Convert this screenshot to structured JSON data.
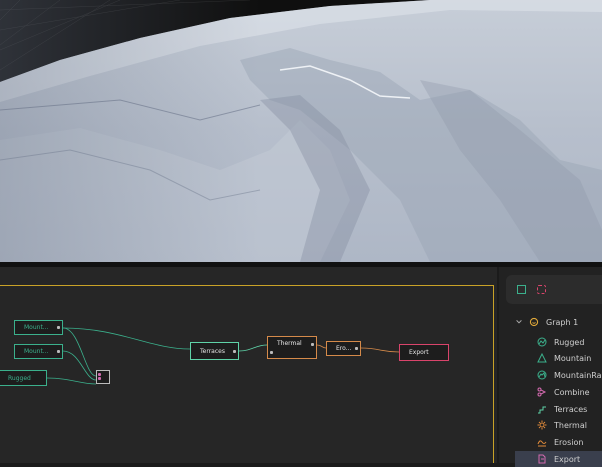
{
  "graph": {
    "nodes": [
      {
        "id": "mount1",
        "label": "Mount...",
        "color": "#3bb08c"
      },
      {
        "id": "mount2",
        "label": "Mount...",
        "color": "#3bb08c"
      },
      {
        "id": "rugged",
        "label": "Rugged",
        "color": "#3bb08c"
      },
      {
        "id": "combine",
        "label": "",
        "color": "#bbbbbb"
      },
      {
        "id": "terraces",
        "label": "Terraces",
        "color": "#5fd3a8"
      },
      {
        "id": "thermal",
        "label": "Thermal",
        "color": "#d58a4a"
      },
      {
        "id": "erosion",
        "label": "Ero...",
        "color": "#d58a4a"
      },
      {
        "id": "export",
        "label": "Export",
        "color": "#d9446b"
      }
    ]
  },
  "sidebar": {
    "toolbar_icons": [
      "fit-view-icon",
      "focus-icon"
    ],
    "tree": {
      "root_label": "Graph 1",
      "items": [
        {
          "label": "Rugged",
          "icon": "rugged-icon",
          "color": "#3bb08c"
        },
        {
          "label": "Mountain",
          "icon": "mountain-icon",
          "color": "#3bb08c"
        },
        {
          "label": "MountainRange",
          "icon": "mountain-range-icon",
          "color": "#3bb08c"
        },
        {
          "label": "Combine",
          "icon": "combine-icon",
          "color": "#d46ab0"
        },
        {
          "label": "Terraces",
          "icon": "terraces-icon",
          "color": "#5fd3a8"
        },
        {
          "label": "Thermal",
          "icon": "thermal-icon",
          "color": "#e08a3a"
        },
        {
          "label": "Erosion",
          "icon": "erosion-icon",
          "color": "#e08a3a"
        },
        {
          "label": "Export",
          "icon": "export-icon",
          "color": "#d46ab0"
        }
      ]
    }
  },
  "colors": {
    "accent_frame": "#c9a227",
    "selection": "#3a3f4d"
  }
}
